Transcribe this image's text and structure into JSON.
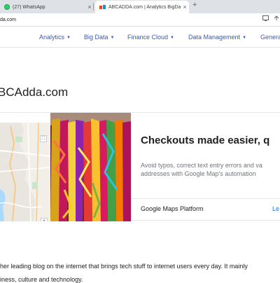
{
  "browser": {
    "tabs": [
      {
        "title": "(27) WhatsApp",
        "icon": "whatsapp-icon",
        "active": false
      },
      {
        "title": "ABCADDA.com | Analytics BigDa",
        "icon": "abcadda-favicon",
        "active": true
      }
    ],
    "close_glyph": "×",
    "new_tab_glyph": "+",
    "url": "da.com"
  },
  "nav": {
    "items": [
      {
        "label": "Analytics"
      },
      {
        "label": "Big Data"
      },
      {
        "label": "Finance Cloud"
      },
      {
        "label": "Data Management"
      },
      {
        "label": "Genera"
      }
    ],
    "caret": "▼",
    "color": "#3558c7"
  },
  "site": {
    "logo_text": "BCAdda.com"
  },
  "ad": {
    "headline": "Checkouts made easier, q",
    "body_line1": "Avoid typos, correct text entry errors and va",
    "body_line2": "addresses with Google Map's automation",
    "brand": "Google Maps Platform",
    "cta": "Le",
    "map_zoom_in": "+",
    "map_zoom_out": "−",
    "cta_color": "#1a73e8"
  },
  "article": {
    "line1": "her leading blog on the internet that brings tech stuff to internet users every day. It mainly",
    "line2": "iness, culture and technology."
  }
}
